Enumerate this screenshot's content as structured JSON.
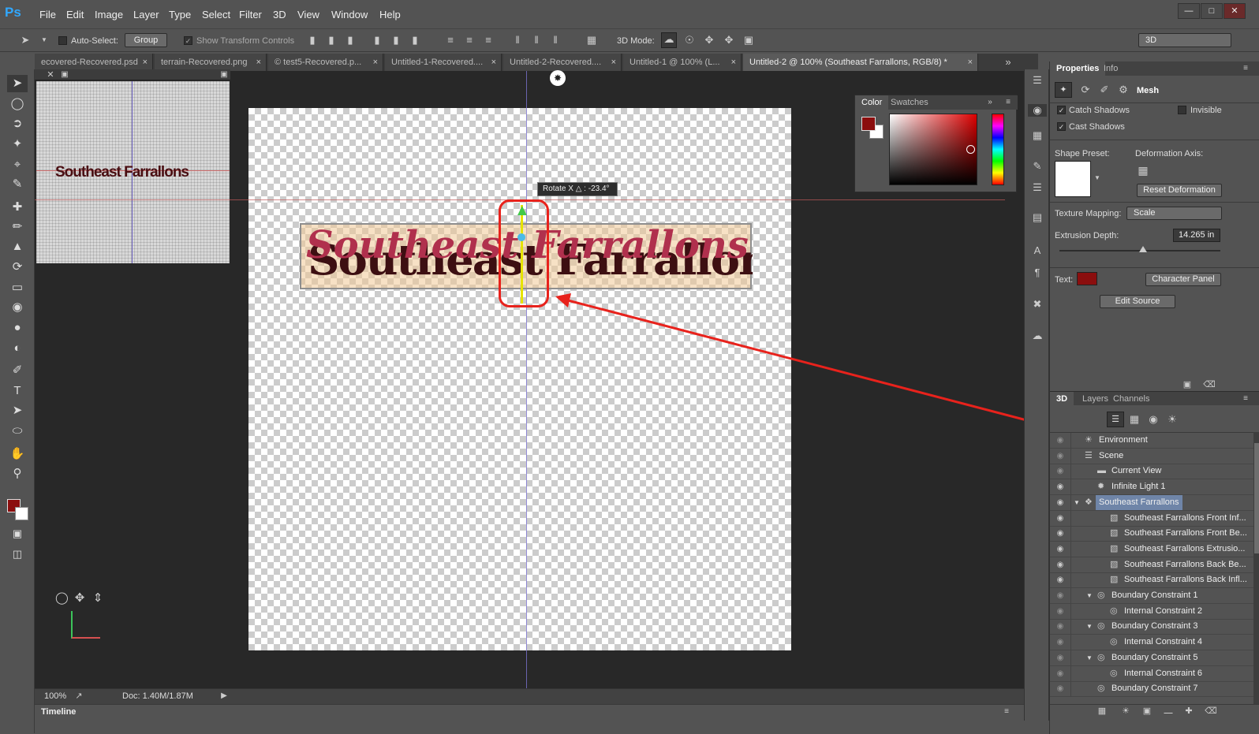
{
  "app": {
    "logo": "Ps"
  },
  "menu": [
    "File",
    "Edit",
    "Image",
    "Layer",
    "Type",
    "Select",
    "Filter",
    "3D",
    "View",
    "Window",
    "Help"
  ],
  "window_buttons": {
    "minimize": "—",
    "restore": "□",
    "close": "✕"
  },
  "options": {
    "auto_select_label": "Auto-Select:",
    "auto_select_value": "Group",
    "show_transform_label": "Show Transform Controls",
    "mode_label": "3D Mode:",
    "workspace": "3D"
  },
  "tabs": [
    {
      "label": "ecovered-Recovered.psd",
      "close": "×"
    },
    {
      "label": "terrain-Recovered.png",
      "close": "×"
    },
    {
      "label": "© test5-Recovered.p...",
      "close": "×"
    },
    {
      "label": "Untitled-1-Recovered....",
      "close": "×"
    },
    {
      "label": "Untitled-2-Recovered....",
      "close": "×"
    },
    {
      "label": "Untitled-1 @ 100% (L...",
      "close": "×"
    },
    {
      "label": "Untitled-2 @ 100% (Southeast Farrallons, RGB/8) *",
      "close": "×"
    }
  ],
  "canvas": {
    "text": "Southeast Farrallons",
    "rotate_label": "Rotate X",
    "rotate_value": "-23.4°"
  },
  "color_panel": {
    "tabs": [
      "Color",
      "Swatches"
    ],
    "foreground": "#8b0e0e",
    "background": "#ffffff"
  },
  "status": {
    "zoom": "100%",
    "doc": "Doc: 1.40M/1.87M"
  },
  "timeline_label": "Timeline",
  "properties": {
    "tabs": [
      "Properties",
      "Info"
    ],
    "heading": "Mesh",
    "catch_shadows": "Catch Shadows",
    "cast_shadows": "Cast Shadows",
    "invisible": "Invisible",
    "shape_preset": "Shape Preset:",
    "deformation_axis": "Deformation Axis:",
    "reset_deformation": "Reset Deformation",
    "texture_mapping_label": "Texture Mapping:",
    "texture_mapping_value": "Scale",
    "extrusion_depth_label": "Extrusion Depth:",
    "extrusion_depth_value": "14.265 in",
    "extrusion_depth_slider": 0.52,
    "text_label": "Text:",
    "text_color": "#8b0e0e",
    "character_panel": "Character Panel",
    "edit_source": "Edit Source"
  },
  "layers_panel": {
    "tabs": [
      "3D",
      "Layers",
      "Channels"
    ],
    "rows": [
      {
        "label": "Environment",
        "indent": 0,
        "eye": false,
        "twirl": "",
        "icon": "☀"
      },
      {
        "label": "Scene",
        "indent": 0,
        "eye": false,
        "twirl": "",
        "icon": "☰"
      },
      {
        "label": "Current View",
        "indent": 1,
        "eye": false,
        "twirl": "",
        "icon": "▬"
      },
      {
        "label": "Infinite Light 1",
        "indent": 1,
        "eye": true,
        "twirl": "",
        "icon": "✹"
      },
      {
        "label": "Southeast Farrallons",
        "indent": 0,
        "eye": true,
        "twirl": "▼",
        "icon": "❖",
        "selected": true
      },
      {
        "label": "Southeast Farrallons Front Inf...",
        "indent": 2,
        "eye": true,
        "twirl": "",
        "icon": "▧"
      },
      {
        "label": "Southeast Farrallons Front Be...",
        "indent": 2,
        "eye": true,
        "twirl": "",
        "icon": "▧"
      },
      {
        "label": "Southeast Farrallons Extrusio...",
        "indent": 2,
        "eye": true,
        "twirl": "",
        "icon": "▧"
      },
      {
        "label": "Southeast Farrallons Back Be...",
        "indent": 2,
        "eye": true,
        "twirl": "",
        "icon": "▧"
      },
      {
        "label": "Southeast Farrallons Back Infl...",
        "indent": 2,
        "eye": true,
        "twirl": "",
        "icon": "▧"
      },
      {
        "label": "Boundary Constraint 1",
        "indent": 1,
        "eye": false,
        "twirl": "▼",
        "icon": "◎"
      },
      {
        "label": "Internal Constraint 2",
        "indent": 2,
        "eye": false,
        "twirl": "",
        "icon": "◎"
      },
      {
        "label": "Boundary Constraint 3",
        "indent": 1,
        "eye": false,
        "twirl": "▼",
        "icon": "◎"
      },
      {
        "label": "Internal Constraint 4",
        "indent": 2,
        "eye": false,
        "twirl": "",
        "icon": "◎"
      },
      {
        "label": "Boundary Constraint 5",
        "indent": 1,
        "eye": false,
        "twirl": "▼",
        "icon": "◎"
      },
      {
        "label": "Internal Constraint 6",
        "indent": 2,
        "eye": false,
        "twirl": "",
        "icon": "◎"
      },
      {
        "label": "Boundary Constraint 7",
        "indent": 1,
        "eye": false,
        "twirl": "",
        "icon": "◎"
      }
    ]
  }
}
